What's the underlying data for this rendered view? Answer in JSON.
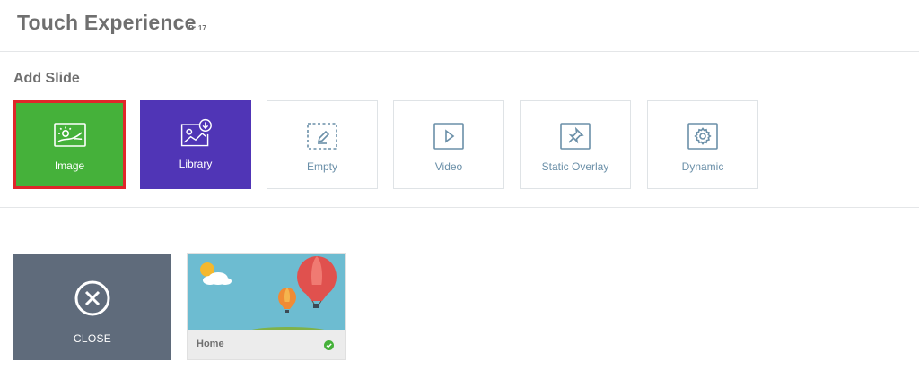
{
  "header": {
    "title": "Touch Experience",
    "id_label": "ID: 17"
  },
  "add_slide": {
    "heading": "Add Slide",
    "tiles": [
      {
        "label": "Image",
        "icon": "image-icon",
        "selected": true,
        "color": "#45b13a"
      },
      {
        "label": "Library",
        "icon": "library-icon",
        "color": "#5035b6"
      },
      {
        "label": "Empty",
        "icon": "empty-slide-icon"
      },
      {
        "label": "Video",
        "icon": "video-icon"
      },
      {
        "label": "Static Overlay",
        "icon": "pin-icon"
      },
      {
        "label": "Dynamic",
        "icon": "gear-icon"
      }
    ]
  },
  "slides": {
    "close_card": {
      "label": "CLOSE",
      "icon": "close-circle-icon"
    },
    "items": [
      {
        "name": "Home",
        "status_icon": "check-circle-icon",
        "status_color": "#45b13a"
      }
    ]
  },
  "colors": {
    "accent_green": "#45b13a",
    "accent_purple": "#5035b6",
    "selection_border": "#e0262a",
    "outline_icon": "#6a8fa8"
  }
}
